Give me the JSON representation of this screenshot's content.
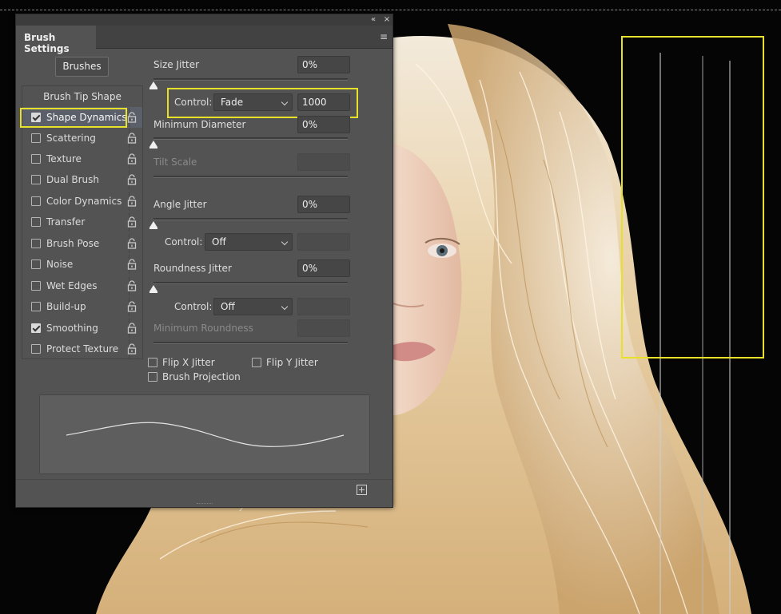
{
  "panel": {
    "title": "Brush Settings",
    "collapse_icon": "«",
    "close_icon": "×",
    "menu_icon": "≡"
  },
  "left": {
    "brushes_button": "Brushes",
    "tip_shape": "Brush Tip Shape",
    "items": [
      {
        "label": "Shape Dynamics",
        "checked": true,
        "selected": true
      },
      {
        "label": "Scattering",
        "checked": false
      },
      {
        "label": "Texture",
        "checked": false
      },
      {
        "label": "Dual Brush",
        "checked": false
      },
      {
        "label": "Color Dynamics",
        "checked": false
      },
      {
        "label": "Transfer",
        "checked": false
      },
      {
        "label": "Brush Pose",
        "checked": false
      },
      {
        "label": "Noise",
        "checked": false
      },
      {
        "label": "Wet Edges",
        "checked": false
      },
      {
        "label": "Build-up",
        "checked": false
      },
      {
        "label": "Smoothing",
        "checked": true
      },
      {
        "label": "Protect Texture",
        "checked": false
      }
    ]
  },
  "dynamics": {
    "size_jitter": {
      "label": "Size Jitter",
      "value": "0%"
    },
    "size_control": {
      "label": "Control:",
      "option": "Fade",
      "value": "1000"
    },
    "min_diameter": {
      "label": "Minimum Diameter",
      "value": "0%"
    },
    "tilt_scale": {
      "label": "Tilt Scale",
      "value": ""
    },
    "angle_jitter": {
      "label": "Angle Jitter",
      "value": "0%"
    },
    "angle_control": {
      "label": "Control:",
      "option": "Off"
    },
    "roundness_jitter": {
      "label": "Roundness Jitter",
      "value": "0%"
    },
    "roundness_control": {
      "label": "Control:",
      "option": "Off"
    },
    "min_roundness": {
      "label": "Minimum Roundness",
      "value": ""
    },
    "flip_x": "Flip X Jitter",
    "flip_y": "Flip Y Jitter",
    "brush_projection": "Brush Projection"
  },
  "colors": {
    "highlight": "#e8e12a",
    "panel_bg": "#535353"
  }
}
